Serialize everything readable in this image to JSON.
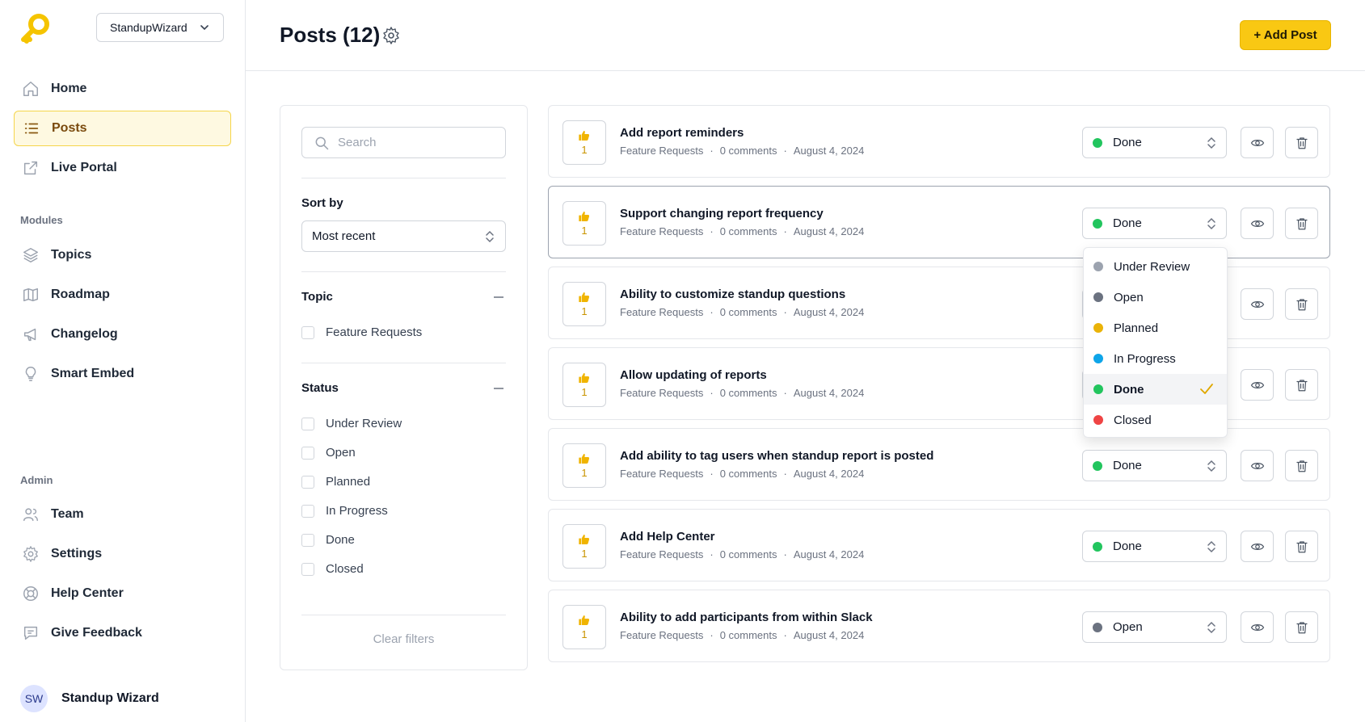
{
  "workspace": {
    "name": "StandupWizard"
  },
  "sidebar": {
    "nav": [
      {
        "label": "Home",
        "icon": "home-icon"
      },
      {
        "label": "Posts",
        "icon": "list-icon",
        "active": true
      },
      {
        "label": "Live Portal",
        "icon": "external-link-icon"
      }
    ],
    "modules_label": "Modules",
    "modules": [
      {
        "label": "Topics",
        "icon": "layers-icon"
      },
      {
        "label": "Roadmap",
        "icon": "map-icon"
      },
      {
        "label": "Changelog",
        "icon": "megaphone-icon"
      },
      {
        "label": "Smart Embed",
        "icon": "lightbulb-icon"
      }
    ],
    "admin_label": "Admin",
    "admin": [
      {
        "label": "Team",
        "icon": "users-icon"
      },
      {
        "label": "Settings",
        "icon": "gear-icon"
      },
      {
        "label": "Help Center",
        "icon": "lifebuoy-icon"
      },
      {
        "label": "Give Feedback",
        "icon": "chat-icon"
      }
    ],
    "user": {
      "initials": "SW",
      "name": "Standup Wizard"
    }
  },
  "header": {
    "title": "Posts (12)",
    "add_post_label": "+ Add Post"
  },
  "filters": {
    "search_placeholder": "Search",
    "sort_label": "Sort by",
    "sort_value": "Most recent",
    "topic_label": "Topic",
    "topics": [
      "Feature Requests"
    ],
    "status_label": "Status",
    "statuses": [
      "Under Review",
      "Open",
      "Planned",
      "In Progress",
      "Done",
      "Closed"
    ],
    "clear_label": "Clear filters"
  },
  "status_colors": {
    "Under Review": "#9ca3af",
    "Open": "#6b7280",
    "Planned": "#eab308",
    "In Progress": "#0ea5e9",
    "Done": "#22c55e",
    "Closed": "#ef4444"
  },
  "posts": [
    {
      "title": "Add report reminders",
      "topic": "Feature Requests",
      "comments": "0 comments",
      "date": "August 4, 2024",
      "votes": "1",
      "status": "Done"
    },
    {
      "title": "Support changing report frequency",
      "topic": "Feature Requests",
      "comments": "0 comments",
      "date": "August 4, 2024",
      "votes": "1",
      "status": "Done"
    },
    {
      "title": "Ability to customize standup questions",
      "topic": "Feature Requests",
      "comments": "0 comments",
      "date": "August 4, 2024",
      "votes": "1",
      "status": "Done"
    },
    {
      "title": "Allow updating of reports",
      "topic": "Feature Requests",
      "comments": "0 comments",
      "date": "August 4, 2024",
      "votes": "1",
      "status": "Done"
    },
    {
      "title": "Add ability to tag users when standup report is posted",
      "topic": "Feature Requests",
      "comments": "0 comments",
      "date": "August 4, 2024",
      "votes": "1",
      "status": "Done"
    },
    {
      "title": "Add Help Center",
      "topic": "Feature Requests",
      "comments": "0 comments",
      "date": "August 4, 2024",
      "votes": "1",
      "status": "Done"
    },
    {
      "title": "Ability to add participants from within Slack",
      "topic": "Feature Requests",
      "comments": "0 comments",
      "date": "August 4, 2024",
      "votes": "1",
      "status": "Open"
    }
  ],
  "status_dropdown": {
    "options": [
      "Under Review",
      "Open",
      "Planned",
      "In Progress",
      "Done",
      "Closed"
    ],
    "selected": "Done"
  }
}
